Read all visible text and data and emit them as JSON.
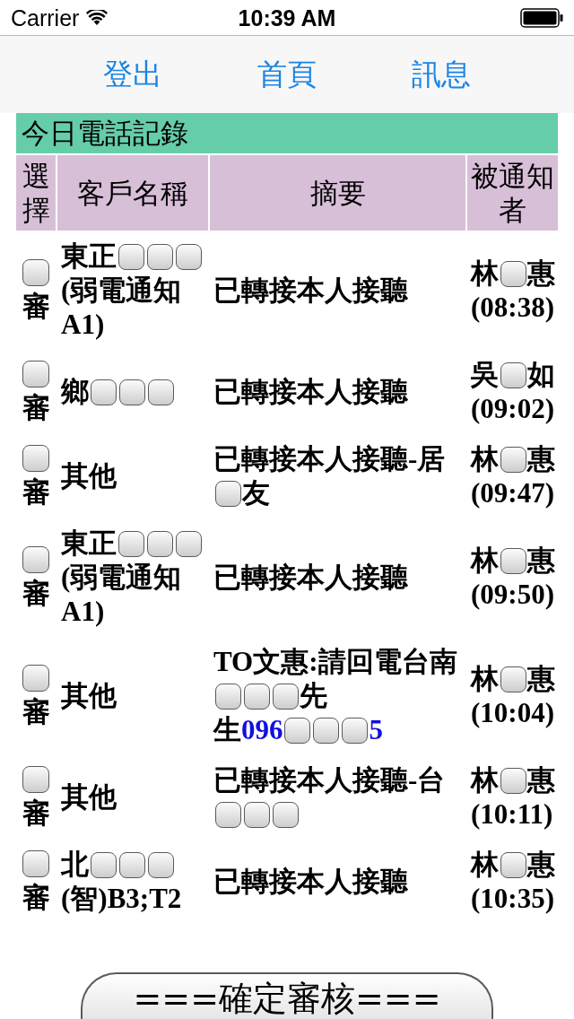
{
  "status_bar": {
    "carrier": "Carrier",
    "time": "10:39 AM"
  },
  "nav": {
    "links": [
      "登出",
      "首頁",
      "訊息"
    ]
  },
  "table": {
    "title": "今日電話記錄",
    "columns": [
      "選擇",
      "客戶名稱",
      "摘要",
      "被通知者"
    ],
    "rows": [
      {
        "checked": false,
        "check_label": "審",
        "customer": [
          [
            {
              "kind": "text",
              "text": "東正"
            },
            {
              "kind": "mask"
            },
            {
              "kind": "mask"
            },
            {
              "kind": "mask"
            }
          ],
          [
            {
              "kind": "text",
              "text": "(弱電通知"
            }
          ],
          [
            {
              "kind": "text",
              "text": "A1)"
            }
          ]
        ],
        "summary": [
          [
            {
              "kind": "text",
              "text": "已轉接本人接聽"
            }
          ]
        ],
        "notifier": [
          {
            "kind": "text",
            "text": "林"
          },
          {
            "kind": "mask"
          },
          {
            "kind": "text",
            "text": "惠"
          }
        ],
        "time": "(08:38)"
      },
      {
        "checked": false,
        "check_label": "審",
        "customer": [
          [
            {
              "kind": "text",
              "text": "鄉"
            },
            {
              "kind": "mask"
            },
            {
              "kind": "mask"
            },
            {
              "kind": "mask"
            }
          ]
        ],
        "summary": [
          [
            {
              "kind": "text",
              "text": "已轉接本人接聽"
            }
          ]
        ],
        "notifier": [
          {
            "kind": "text",
            "text": "吳"
          },
          {
            "kind": "mask"
          },
          {
            "kind": "text",
            "text": "如"
          }
        ],
        "time": "(09:02)"
      },
      {
        "checked": false,
        "check_label": "審",
        "customer": [
          [
            {
              "kind": "text",
              "text": "其他"
            }
          ]
        ],
        "summary": [
          [
            {
              "kind": "text",
              "text": "已轉接本人接聽-居"
            }
          ],
          [
            {
              "kind": "mask"
            },
            {
              "kind": "text",
              "text": "友"
            }
          ]
        ],
        "notifier": [
          {
            "kind": "text",
            "text": "林"
          },
          {
            "kind": "mask"
          },
          {
            "kind": "text",
            "text": "惠"
          }
        ],
        "time": "(09:47)"
      },
      {
        "checked": false,
        "check_label": "審",
        "customer": [
          [
            {
              "kind": "text",
              "text": "東正"
            },
            {
              "kind": "mask"
            },
            {
              "kind": "mask"
            },
            {
              "kind": "mask"
            }
          ],
          [
            {
              "kind": "text",
              "text": "(弱電通知"
            }
          ],
          [
            {
              "kind": "text",
              "text": "A1)"
            }
          ]
        ],
        "summary": [
          [
            {
              "kind": "text",
              "text": "已轉接本人接聽"
            }
          ]
        ],
        "notifier": [
          {
            "kind": "text",
            "text": "林"
          },
          {
            "kind": "mask"
          },
          {
            "kind": "text",
            "text": "惠"
          }
        ],
        "time": "(09:50)"
      },
      {
        "checked": false,
        "check_label": "審",
        "customer": [
          [
            {
              "kind": "text",
              "text": "其他"
            }
          ]
        ],
        "summary": [
          [
            {
              "kind": "text",
              "text": "TO文惠:請回電台南"
            }
          ],
          [
            {
              "kind": "mask"
            },
            {
              "kind": "mask"
            },
            {
              "kind": "mask"
            },
            {
              "kind": "text",
              "text": "先"
            }
          ],
          [
            {
              "kind": "text",
              "text": "生"
            },
            {
              "kind": "phone",
              "text": "096"
            },
            {
              "kind": "mask"
            },
            {
              "kind": "mask"
            },
            {
              "kind": "mask"
            },
            {
              "kind": "phone",
              "text": "5"
            }
          ]
        ],
        "notifier": [
          {
            "kind": "text",
            "text": "林"
          },
          {
            "kind": "mask"
          },
          {
            "kind": "text",
            "text": "惠"
          }
        ],
        "time": "(10:04)"
      },
      {
        "checked": false,
        "check_label": "審",
        "customer": [
          [
            {
              "kind": "text",
              "text": "其他"
            }
          ]
        ],
        "summary": [
          [
            {
              "kind": "text",
              "text": "已轉接本人接聽-台"
            }
          ],
          [
            {
              "kind": "mask"
            },
            {
              "kind": "mask"
            },
            {
              "kind": "mask"
            }
          ]
        ],
        "notifier": [
          {
            "kind": "text",
            "text": "林"
          },
          {
            "kind": "mask"
          },
          {
            "kind": "text",
            "text": "惠"
          }
        ],
        "time": "(10:11)"
      },
      {
        "checked": false,
        "check_label": "審",
        "customer": [
          [
            {
              "kind": "text",
              "text": "北"
            },
            {
              "kind": "mask"
            },
            {
              "kind": "mask"
            },
            {
              "kind": "mask"
            }
          ],
          [
            {
              "kind": "text",
              "text": "(智)B3;T2"
            }
          ]
        ],
        "summary": [
          [
            {
              "kind": "text",
              "text": "已轉接本人接聽"
            }
          ]
        ],
        "notifier": [
          {
            "kind": "text",
            "text": "林"
          },
          {
            "kind": "mask"
          },
          {
            "kind": "text",
            "text": "惠"
          }
        ],
        "time": "(10:35)"
      }
    ]
  },
  "confirm_button": "===確定審核==="
}
